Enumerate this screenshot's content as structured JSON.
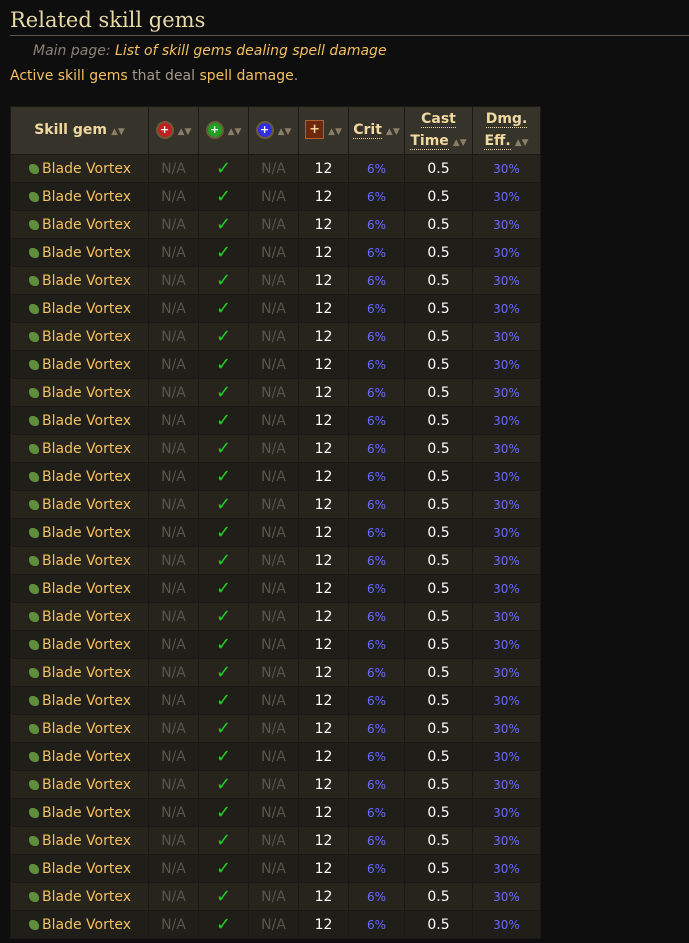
{
  "heading": "Related skill gems",
  "hatnote": {
    "label": "Main page:",
    "link": "List of skill gems dealing spell damage"
  },
  "intro": {
    "link1": "Active skill gems",
    "text": "that deal",
    "link2": "spell damage",
    "end": "."
  },
  "columns": {
    "gem": "Skill gem",
    "str": "strength-icon",
    "dex": "dexterity-icon",
    "int": "intelligence-icon",
    "level": "level-icon",
    "crit": "Crit",
    "cast1": "Cast",
    "cast2": "Time",
    "dmg1": "Dmg.",
    "dmg2": "Eff."
  },
  "colors": {
    "str": "#c02020",
    "dex": "#20a020",
    "int": "#3030e0"
  },
  "rows": [
    {
      "name": "Blade Vortex",
      "str": "N/A",
      "dex": true,
      "int": "N/A",
      "level": "12",
      "crit": "6%",
      "cast": "0.5",
      "dmg": "30%"
    }
  ],
  "row_count": 28
}
